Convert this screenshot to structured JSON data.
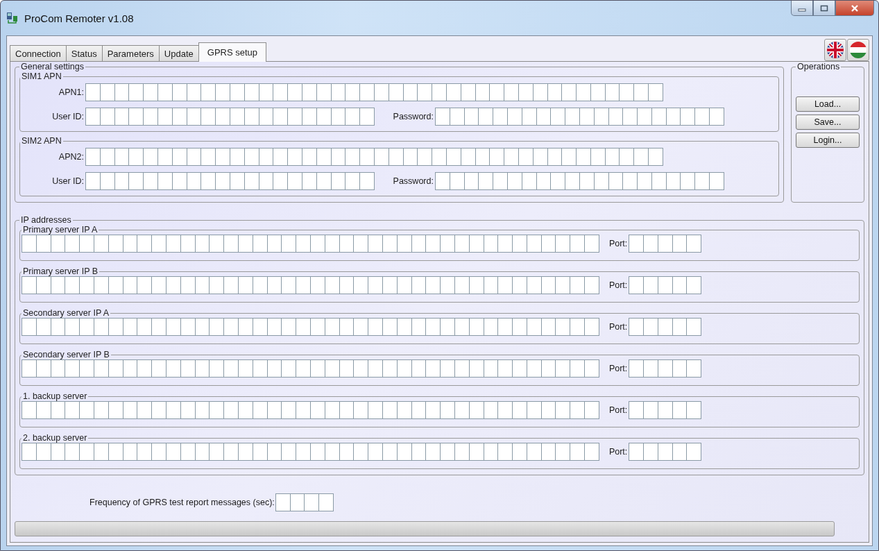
{
  "window": {
    "title": "ProCom Remoter v1.08"
  },
  "tabs": [
    {
      "label": "Connection",
      "selected": false
    },
    {
      "label": "Status",
      "selected": false
    },
    {
      "label": "Parameters",
      "selected": false
    },
    {
      "label": "Update",
      "selected": false
    },
    {
      "label": "GPRS setup",
      "selected": true
    }
  ],
  "language_buttons": [
    {
      "kind": "uk"
    },
    {
      "kind": "hu"
    }
  ],
  "general_settings": {
    "title": "General settings",
    "groups": [
      {
        "title": "SIM1 APN",
        "apn": {
          "label": "APN1:"
        },
        "user_id": {
          "label": "User ID:"
        },
        "password": {
          "label": "Password:"
        }
      },
      {
        "title": "SIM2 APN",
        "apn": {
          "label": "APN2:"
        },
        "user_id": {
          "label": "User ID:"
        },
        "password": {
          "label": "Password:"
        }
      }
    ]
  },
  "operations": {
    "title": "Operations",
    "buttons": [
      "Load...",
      "Save...",
      "Login..."
    ]
  },
  "ip_addresses": {
    "title": "IP addresses",
    "servers": [
      {
        "title": "Primary server IP A",
        "port_label": "Port:"
      },
      {
        "title": "Primary server IP B",
        "port_label": "Port:"
      },
      {
        "title": "Secondary server IP A",
        "port_label": "Port:"
      },
      {
        "title": "Secondary server IP B",
        "port_label": "Port:"
      },
      {
        "title": "1. backup server",
        "port_label": "Port:"
      },
      {
        "title": "2. backup server",
        "port_label": "Port:"
      }
    ]
  },
  "frequency": {
    "label": "Frequency of GPRS test report messages (sec):"
  },
  "progress": {
    "level": 0
  }
}
